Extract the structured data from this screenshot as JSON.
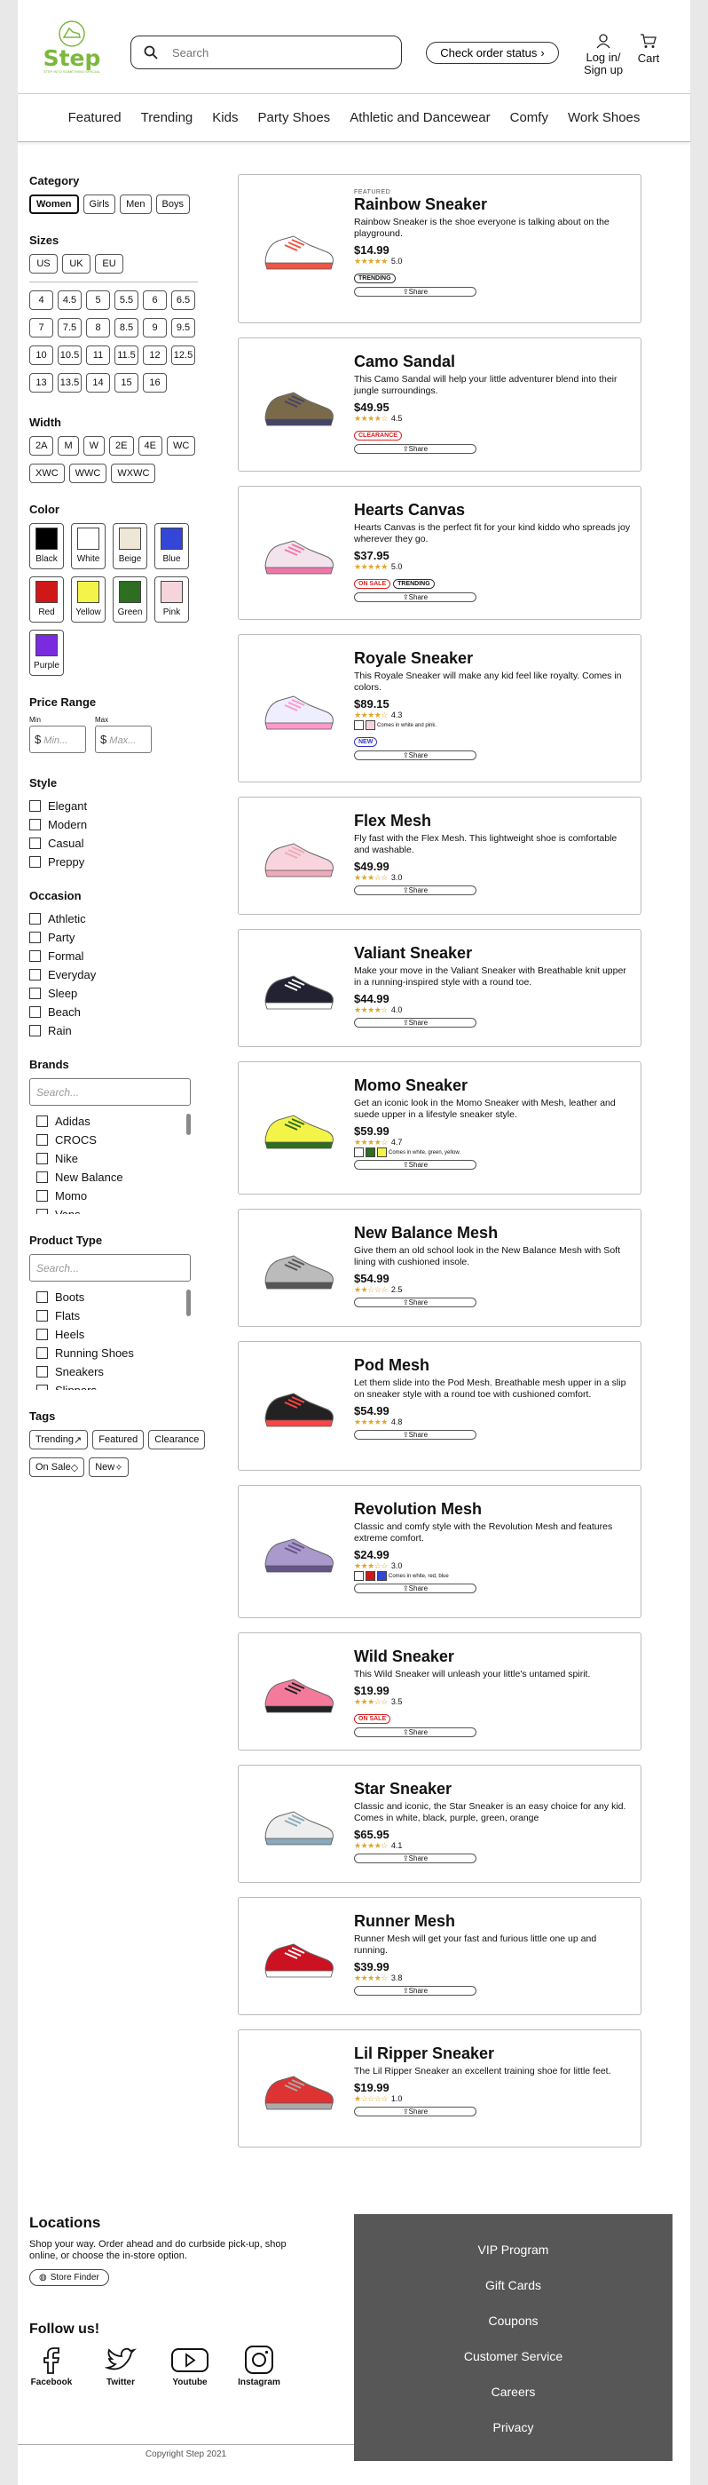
{
  "header": {
    "brand": "Step",
    "brand_tagline": "STEP INTO SOMETHING SPECIAL",
    "search_placeholder": "Search",
    "order_status": "Check order status",
    "login": "Log in/ Sign up",
    "cart": "Cart"
  },
  "nav": [
    "Featured",
    "Trending",
    "Kids",
    "Party Shoes",
    "Athletic and Dancewear",
    "Comfy",
    "Work Shoes"
  ],
  "filters": {
    "category": {
      "title": "Category",
      "options": [
        "Women",
        "Girls",
        "Men",
        "Boys"
      ],
      "selected": "Women"
    },
    "sizes": {
      "title": "Sizes",
      "systems": [
        "US",
        "UK",
        "EU"
      ],
      "values": [
        "4",
        "4.5",
        "5",
        "5.5",
        "6",
        "6.5",
        "7",
        "7.5",
        "8",
        "8.5",
        "9",
        "9.5",
        "10",
        "10.5",
        "11",
        "11.5",
        "12",
        "12.5",
        "13",
        "13.5",
        "14",
        "15",
        "16"
      ]
    },
    "width": {
      "title": "Width",
      "options": [
        "2A",
        "M",
        "W",
        "2E",
        "4E",
        "WC",
        "XWC",
        "WWC",
        "WXWC"
      ]
    },
    "color": {
      "title": "Color",
      "options": [
        {
          "name": "Black",
          "hex": "#000000"
        },
        {
          "name": "White",
          "hex": "#ffffff"
        },
        {
          "name": "Beige",
          "hex": "#eee6d6"
        },
        {
          "name": "Blue",
          "hex": "#3346d6"
        },
        {
          "name": "Red",
          "hex": "#d01818"
        },
        {
          "name": "Yellow",
          "hex": "#f4f448"
        },
        {
          "name": "Green",
          "hex": "#2e6e20"
        },
        {
          "name": "Pink",
          "hex": "#f6d4dc"
        },
        {
          "name": "Purple",
          "hex": "#7a2be0"
        }
      ]
    },
    "price": {
      "title": "Price Range",
      "min_label": "Min",
      "max_label": "Max",
      "min_placeholder": "Min...",
      "max_placeholder": "Max..."
    },
    "style": {
      "title": "Style",
      "options": [
        "Elegant",
        "Modern",
        "Casual",
        "Preppy"
      ]
    },
    "occasion": {
      "title": "Occasion",
      "options": [
        "Athletic",
        "Party",
        "Formal",
        "Everyday",
        "Sleep",
        "Beach",
        "Rain"
      ]
    },
    "brands": {
      "title": "Brands",
      "placeholder": "Search...",
      "options": [
        "Adidas",
        "CROCS",
        "Nike",
        "New Balance",
        "Momo",
        "Vans"
      ]
    },
    "product_type": {
      "title": "Product Type",
      "placeholder": "Search...",
      "options": [
        "Boots",
        "Flats",
        "Heels",
        "Running Shoes",
        "Sneakers",
        "Slippers"
      ]
    },
    "tags": {
      "title": "Tags",
      "options": [
        "Trending",
        "Featured",
        "Clearance",
        "On Sale",
        "New"
      ]
    }
  },
  "products": [
    {
      "featured": "FEATURED",
      "name": "Rainbow Sneaker",
      "desc": "Rainbow Sneaker is the shoe everyone is talking about on the playground.",
      "price": "$14.99",
      "rating": "5.0",
      "stars": 5,
      "badges": [
        {
          "t": "TRENDING",
          "k": ""
        }
      ],
      "share": "Share",
      "h": 168
    },
    {
      "name": "Camo Sandal",
      "desc": "This Camo Sandal will help your little adventurer blend into their jungle surroundings.",
      "price": "$49.95",
      "rating": "4.5",
      "stars": 4.5,
      "badges": [
        {
          "t": "CLEARANCE",
          "k": "red"
        }
      ],
      "share": "Share",
      "h": 151
    },
    {
      "name": "Hearts Canvas",
      "desc": "Hearts Canvas is the perfect fit for your kind kiddo who spreads joy wherever they go.",
      "price": "$37.95",
      "rating": "5.0",
      "stars": 5,
      "badges": [
        {
          "t": "ON SALE",
          "k": "red"
        },
        {
          "t": "TRENDING",
          "k": ""
        }
      ],
      "share": "Share",
      "h": 151
    },
    {
      "name": "Royale Sneaker",
      "desc": "This Royale Sneaker will make any kid feel like royalty. Comes in colors.",
      "price": "$89.15",
      "rating": "4.3",
      "stars": 4.3,
      "colors": [
        "#ffffff",
        "#f6d4dc"
      ],
      "colors_note": "Comes in white and pink.",
      "badges": [
        {
          "t": "NEW",
          "k": "blue"
        }
      ],
      "share": "Share",
      "h": 167
    },
    {
      "name": "Flex Mesh",
      "desc": "Fly fast with the Flex Mesh. This lightweight shoe is comfortable and washable.",
      "price": "$49.99",
      "rating": "3.0",
      "stars": 3,
      "share": "Share",
      "h": 133
    },
    {
      "name": "Valiant Sneaker",
      "desc": "Make your move in the Valiant Sneaker with Breathable knit upper in a running-inspired style with a round toe.",
      "price": "$44.99",
      "rating": "4.0",
      "stars": 4,
      "share": "Share",
      "h": 133
    },
    {
      "name": "Momo Sneaker",
      "desc": "Get an iconic look in the Momo Sneaker with Mesh, leather and suede upper in a lifestyle sneaker style.",
      "price": "$59.99",
      "rating": "4.7",
      "stars": 4.7,
      "colors": [
        "#ffffff",
        "#2e6e20",
        "#f4f448"
      ],
      "colors_note": "Comes in white, green, yellow.",
      "share": "Share",
      "h": 150
    },
    {
      "name": "New Balance Mesh",
      "desc": "Give them an old school look in the New Balance Mesh with Soft lining with cushioned insole.",
      "price": "$54.99",
      "rating": "2.5",
      "stars": 2.5,
      "share": "Share",
      "h": 133
    },
    {
      "name": "Pod Mesh",
      "desc": "Let them slide into the Pod Mesh. Breathable mesh upper in a slip on sneaker style with a round toe with cushioned comfort.",
      "price": "$54.99",
      "rating": "4.8",
      "stars": 4.8,
      "share": "Share",
      "h": 146
    },
    {
      "name": "Revolution Mesh",
      "desc": "Classic and comfy style with the Revolution Mesh and features extreme comfort.",
      "price": "$24.99",
      "rating": "3.0",
      "stars": 3,
      "colors": [
        "#ffffff",
        "#d01818",
        "#3346d6"
      ],
      "colors_note": "Comes in white, red, blue",
      "share": "Share",
      "h": 150
    },
    {
      "name": "Wild Sneaker",
      "desc": "This Wild Sneaker will unleash your little's untamed spirit.",
      "price": "$19.99",
      "rating": "3.5",
      "stars": 3.5,
      "badges": [
        {
          "t": "ON SALE",
          "k": "red"
        }
      ],
      "share": "Share",
      "h": 133
    },
    {
      "name": "Star Sneaker",
      "desc": "Classic and iconic, the Star Sneaker is an easy choice for any kid. Comes in white, black, purple, green, orange",
      "price": "$65.95",
      "rating": "4.1",
      "stars": 4.1,
      "share": "Share",
      "h": 133
    },
    {
      "name": "Runner Mesh",
      "desc": "Runner Mesh will get your fast and furious little one up and running.",
      "price": "$39.99",
      "rating": "3.8",
      "stars": 3.8,
      "share": "Share",
      "h": 133
    },
    {
      "name": "Lil Ripper Sneaker",
      "desc": "The Lil Ripper Sneaker an excellent training shoe for little feet.",
      "price": "$19.99",
      "rating": "1.0",
      "stars": 1,
      "share": "Share",
      "h": 133
    }
  ],
  "footer": {
    "locations_title": "Locations",
    "locations_text": "Shop your way. Order ahead and do curbside pick-up, shop online, or choose the in-store option.",
    "store_finder": "Store Finder",
    "follow": "Follow us!",
    "social": [
      "Facebook",
      "Twitter",
      "Youtube",
      "Instagram"
    ],
    "links": [
      "VIP Program",
      "Gift Cards",
      "Coupons",
      "Customer Service",
      "Careers",
      "Privacy"
    ],
    "copyright": "Copyright Step 2021"
  }
}
